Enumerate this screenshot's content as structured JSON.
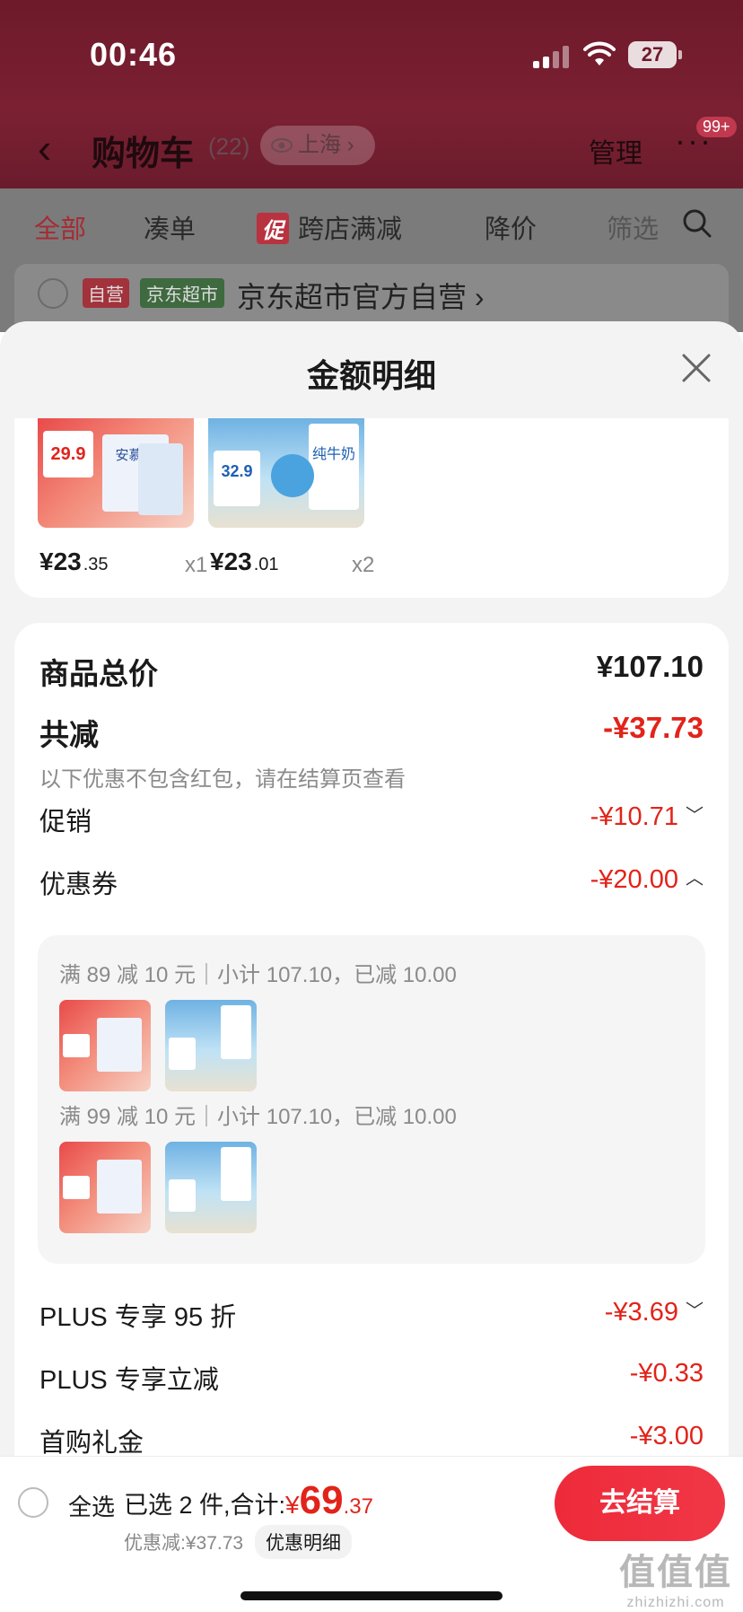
{
  "status_bar": {
    "time": "00:46",
    "battery": "27"
  },
  "nav": {
    "back_icon": "chevron-left-icon",
    "title": "购物车",
    "count": "(22)",
    "location": "上海",
    "manage": "管理",
    "more": "···",
    "badge": "99+"
  },
  "tabs": [
    {
      "label": "全部",
      "active": true
    },
    {
      "label": "凑单"
    },
    {
      "label": "跨店满减",
      "tag": "促"
    },
    {
      "label": "降价"
    },
    {
      "label": "筛选"
    }
  ],
  "store": {
    "tag_self": "自营",
    "tag_super": "京东超市",
    "name": "京东超市官方自营"
  },
  "sheet": {
    "title": "金额明细",
    "products": [
      {
        "price_int": "¥23",
        "price_dec": ".35",
        "qty": "x1",
        "label": "安慕希",
        "promo": "29.9"
      },
      {
        "price_int": "¥23",
        "price_dec": ".01",
        "qty": "x2",
        "label": "纯牛奶",
        "promo": "32.9"
      }
    ],
    "total_label": "商品总价",
    "total_value": "¥107.10",
    "reduce_label": "共减",
    "reduce_value": "-¥37.73",
    "reduce_note": "以下优惠不包含红包，请在结算页查看",
    "items": [
      {
        "label": "促销",
        "value": "-¥10.71",
        "chevron": "﹀"
      },
      {
        "label": "优惠券",
        "value": "-¥20.00",
        "chevron": "︿"
      }
    ],
    "coupons": [
      {
        "text": "满 89 减 10 元｜小计 107.10，已减 10.00"
      },
      {
        "text": "满 99 减 10 元｜小计 107.10，已减 10.00"
      }
    ],
    "extra_items": [
      {
        "label": "PLUS 专享 95 折",
        "value": "-¥3.69",
        "chevron": "﹀"
      },
      {
        "label": "PLUS 专享立减",
        "value": "-¥0.33",
        "chevron": ""
      },
      {
        "label": "首购礼金",
        "value": "-¥3.00",
        "chevron": ""
      }
    ]
  },
  "bottom": {
    "select_all": "全选",
    "summary_prefix": "已选 2 件,合计:",
    "yen": "¥",
    "total_int": "69",
    "total_dec": ".37",
    "discount": "优惠减:¥37.73",
    "detail_button": "优惠明细",
    "checkout": "去结算"
  },
  "watermark": {
    "logo": "值值值",
    "url": "zhizhizhi.com"
  },
  "colors": {
    "accent": "#e2231a",
    "brand": "#a52c35",
    "checkout": "#ee2a3a"
  }
}
